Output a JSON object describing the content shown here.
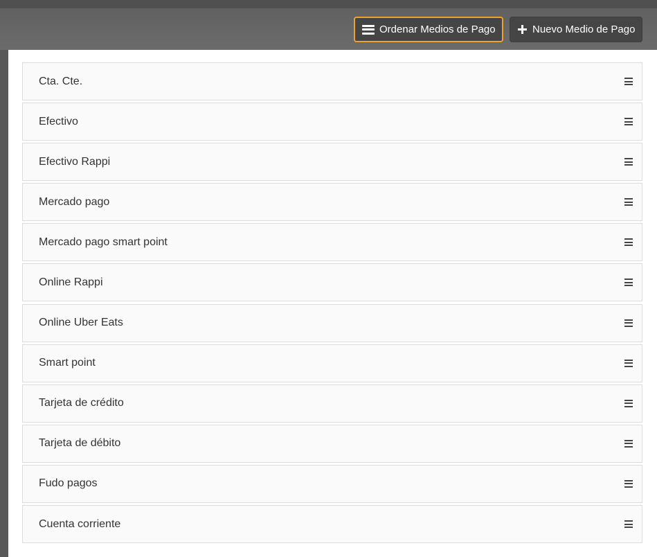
{
  "toolbar": {
    "order_button_label": "Ordenar Medios de Pago",
    "order_button_icon": "bars-icon",
    "new_button_label": "Nuevo Medio de Pago",
    "new_button_icon": "plus-icon",
    "focus_color": "#f0a030"
  },
  "payment_methods": [
    {
      "label": "Cta. Cte."
    },
    {
      "label": "Efectivo"
    },
    {
      "label": "Efectivo Rappi"
    },
    {
      "label": "Mercado pago"
    },
    {
      "label": "Mercado pago smart point"
    },
    {
      "label": "Online Rappi"
    },
    {
      "label": "Online Uber Eats"
    },
    {
      "label": "Smart point"
    },
    {
      "label": "Tarjeta de crédito"
    },
    {
      "label": "Tarjeta de débito"
    },
    {
      "label": "Fudo pagos"
    },
    {
      "label": "Cuenta corriente"
    }
  ],
  "item_handle_icon": "drag-handle-icon"
}
